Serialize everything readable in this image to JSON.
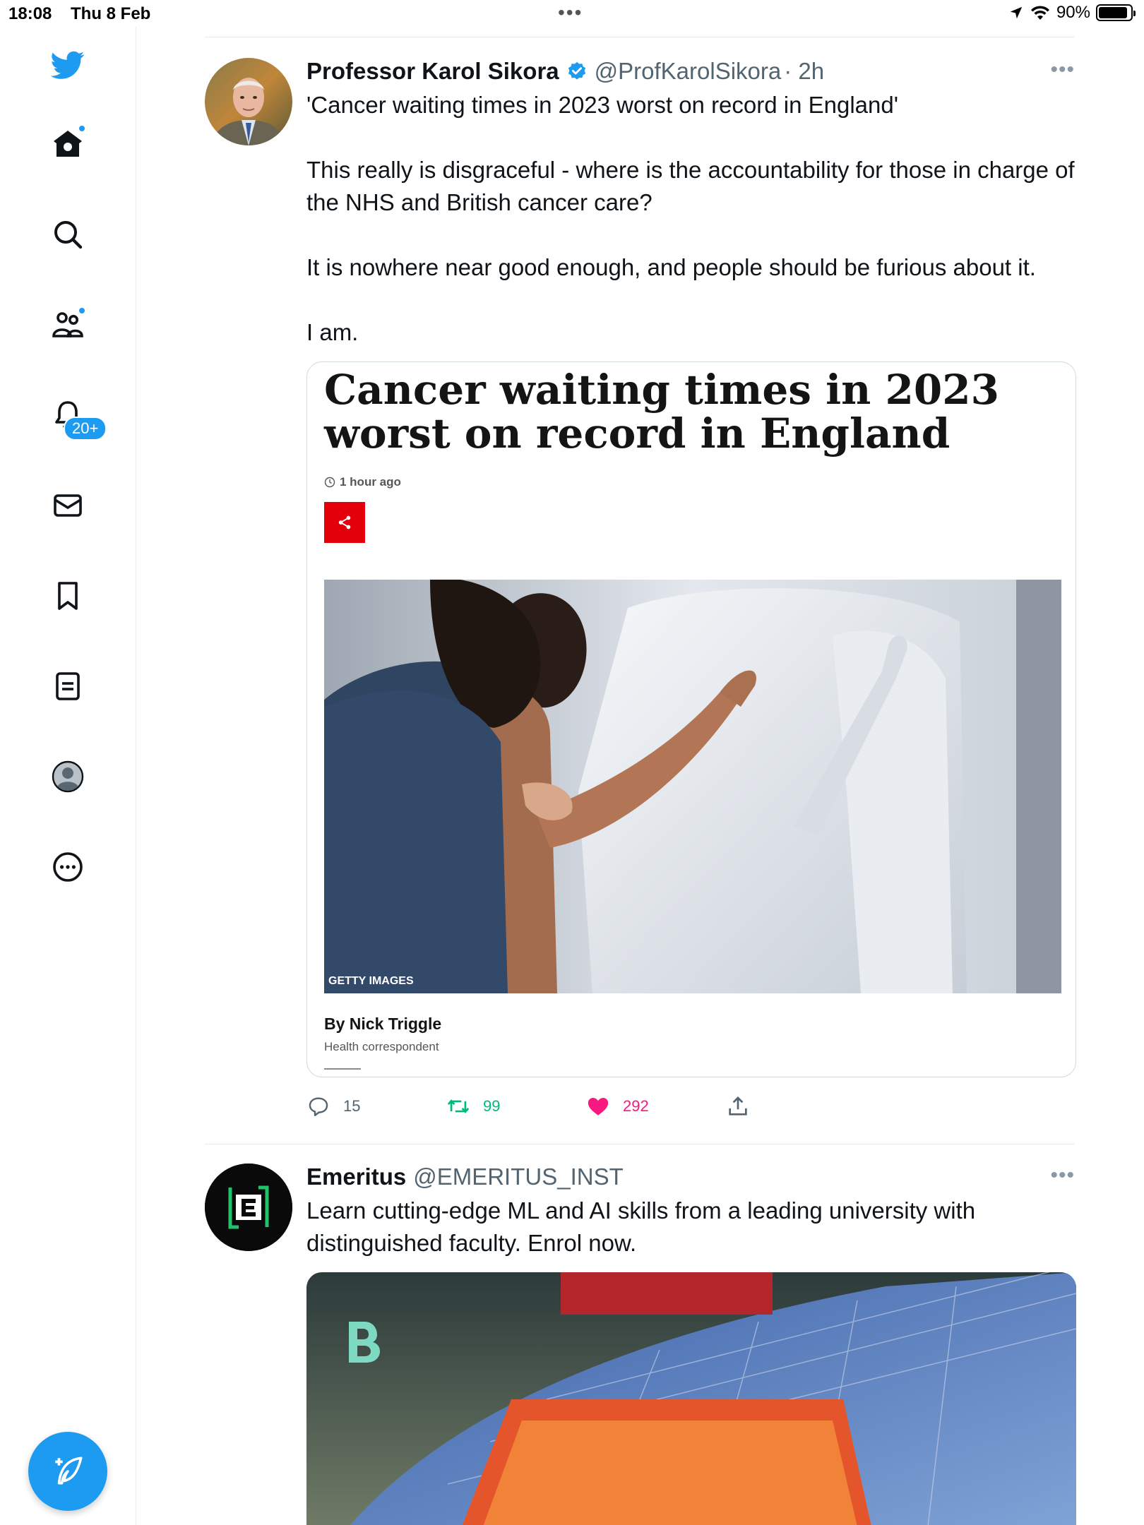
{
  "status_bar": {
    "time": "18:08",
    "date": "Thu 8 Feb",
    "battery": "90%",
    "battery_level": 0.9,
    "icons": [
      "location-icon",
      "wifi-icon",
      "battery-icon"
    ]
  },
  "sidebar": {
    "items": [
      {
        "name": "home",
        "icon": "home-icon"
      },
      {
        "name": "explore",
        "icon": "search-icon"
      },
      {
        "name": "communities",
        "icon": "communities-icon"
      },
      {
        "name": "notifications",
        "icon": "bell-icon",
        "badge": "20+"
      },
      {
        "name": "messages",
        "icon": "mail-icon"
      },
      {
        "name": "bookmarks",
        "icon": "bookmark-icon"
      },
      {
        "name": "lists",
        "icon": "list-icon"
      },
      {
        "name": "profile",
        "icon": "profile-icon"
      },
      {
        "name": "more",
        "icon": "more-circle-icon"
      }
    ],
    "compose_icon": "compose-icon",
    "accent_color": "#1d9bf0"
  },
  "tweet1": {
    "name": "Professor Karol Sikora",
    "handle": "@ProfKarolSikora",
    "time": "· 2h",
    "text": "'Cancer waiting times in 2023 worst on record in England'\n\nThis really is disgraceful - where is the accountability for those in charge of the NHS and British cancer care?\n\nIt is nowhere near good enough, and people should be furious about it.\n\nI am.",
    "card": {
      "title": "Cancer waiting times in 2023 worst on record in England",
      "time": "1 hour ago",
      "photo_credit": "GETTY IMAGES",
      "byline": "By Nick Triggle",
      "role": "Health correspondent"
    },
    "replies": "15",
    "retweets": "99",
    "likes": "292",
    "retweet_color": "#00ba7c",
    "like_color": "#f91880"
  },
  "tweet2": {
    "name": "Emeritus",
    "handle": "@EMERITUS_INST",
    "text": "Learn cutting-edge ML and AI skills from a leading university with distinguished faculty. Enrol now."
  }
}
